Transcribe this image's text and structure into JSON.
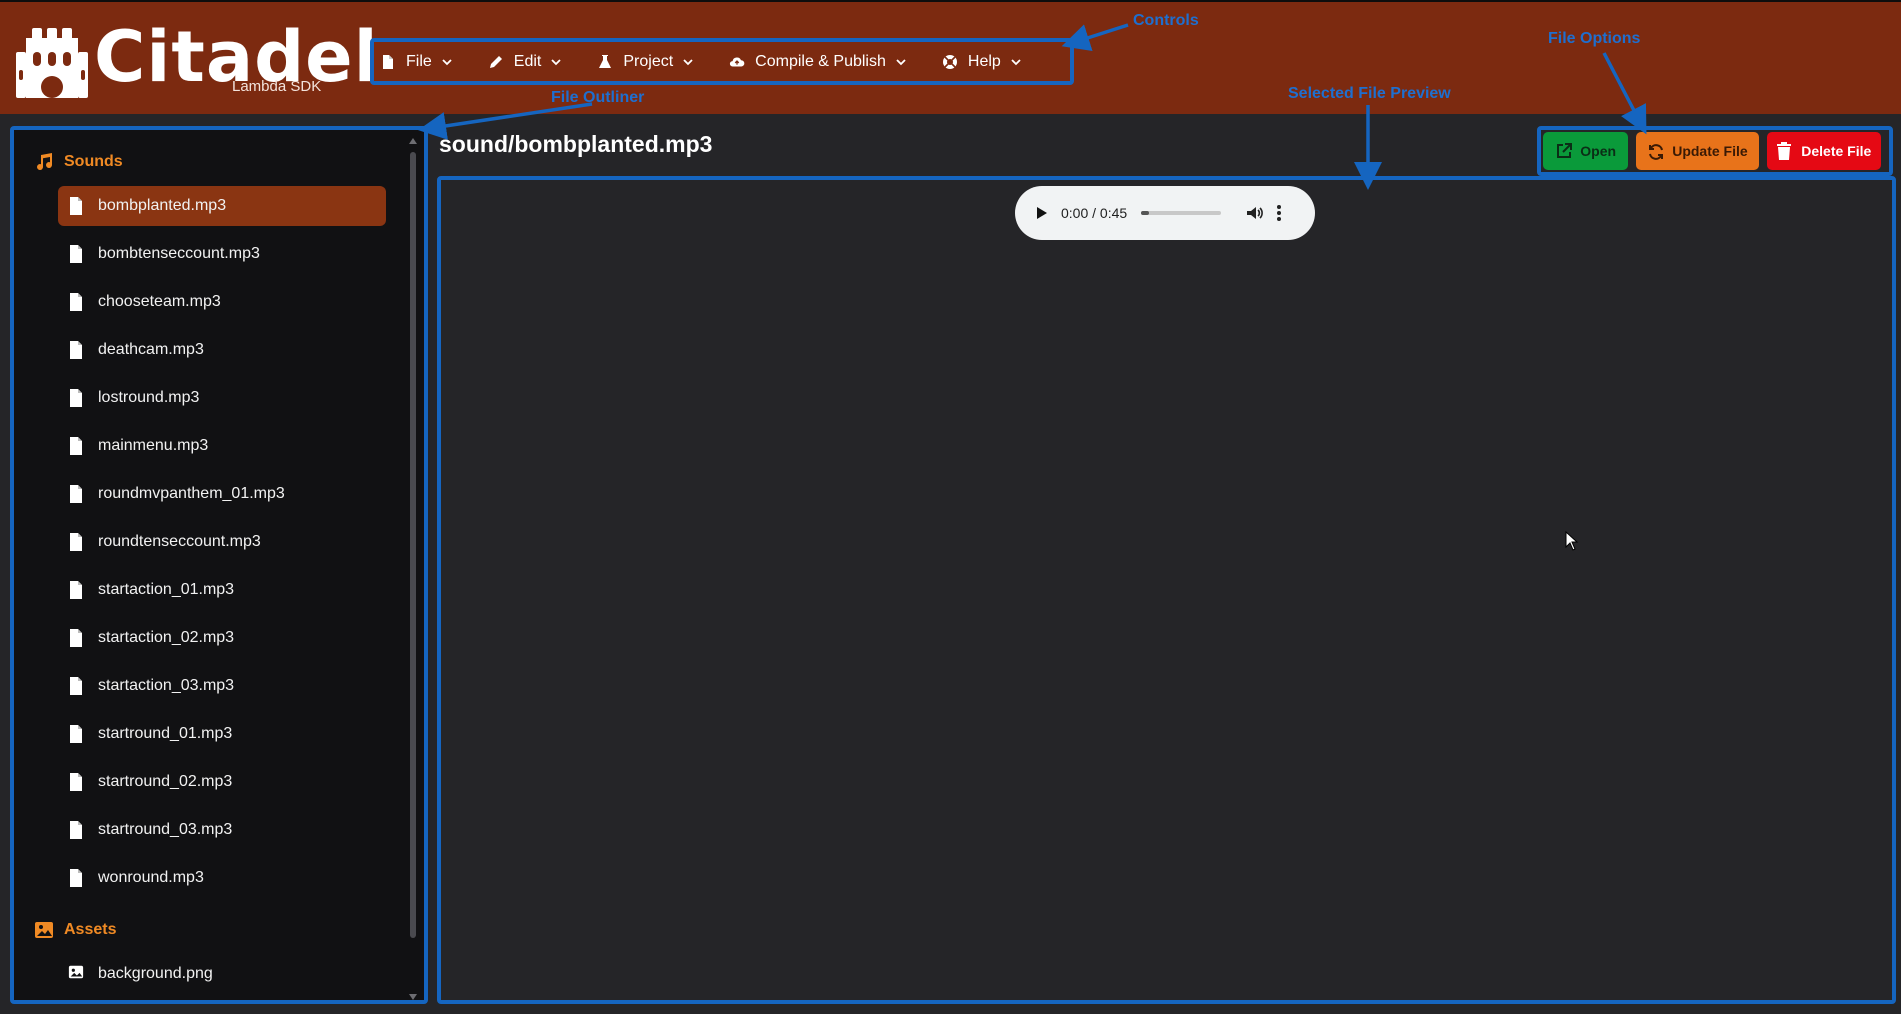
{
  "app": {
    "title": "Citadel",
    "subtitle": "Lambda SDK"
  },
  "menu": [
    {
      "label": "File",
      "icon": "file-icon"
    },
    {
      "label": "Edit",
      "icon": "pencil-icon"
    },
    {
      "label": "Project",
      "icon": "flask-icon"
    },
    {
      "label": "Compile & Publish",
      "icon": "cloud-upload-icon"
    },
    {
      "label": "Help",
      "icon": "lifebuoy-icon"
    }
  ],
  "annotations": {
    "controls": "Controls",
    "file_outliner": "File Outliner",
    "selected_file_preview": "Selected File Preview",
    "file_options": "File Options"
  },
  "sidebar": {
    "sections": [
      {
        "label": "Sounds",
        "icon": "music-note-icon",
        "files": [
          "bombplanted.mp3",
          "bombtenseccount.mp3",
          "chooseteam.mp3",
          "deathcam.mp3",
          "lostround.mp3",
          "mainmenu.mp3",
          "roundmvpanthem_01.mp3",
          "roundtenseccount.mp3",
          "startaction_01.mp3",
          "startaction_02.mp3",
          "startaction_03.mp3",
          "startround_01.mp3",
          "startround_02.mp3",
          "startround_03.mp3",
          "wonround.mp3"
        ],
        "selected": "bombplanted.mp3"
      },
      {
        "label": "Assets",
        "icon": "image-icon",
        "files": [
          "background.png"
        ]
      }
    ]
  },
  "preview": {
    "path": "sound/bombplanted.mp3",
    "audio": {
      "time": "0:00 / 0:45",
      "progress": 0.1
    }
  },
  "options": {
    "open": "Open",
    "update": "Update File",
    "delete": "Delete File"
  },
  "colors": {
    "header": "#7c2a10",
    "accent": "#f08a24",
    "selected": "#8a3512",
    "annotation": "#1565c0",
    "open": "#0a9a3a",
    "update": "#e8731a",
    "delete": "#e50914"
  }
}
